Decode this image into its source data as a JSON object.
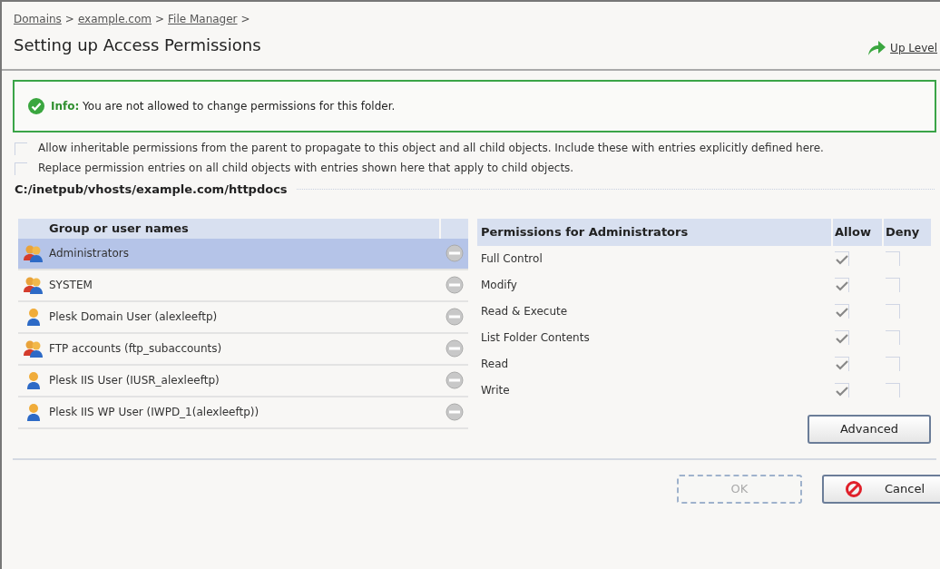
{
  "breadcrumb": [
    {
      "label": "Domains"
    },
    {
      "label": "example.com"
    },
    {
      "label": "File Manager"
    }
  ],
  "separator": ">",
  "title": "Setting up Access Permissions",
  "up_level": "Up Level",
  "info": "**Info:** You are not allowed to change permissions for this folder.",
  "options": [
    {
      "label": "Allow inheritable permissions from the parent to propagate to this object and all child objects. Include these with entries explicitly defined here.",
      "checked": false
    },
    {
      "label": "Replace permission entries on all child objects with entries shown here that apply to child objects.",
      "checked": false
    }
  ],
  "path": "C:/inetpub/vhosts/example.com/httpdocs",
  "users": {
    "heading": "Group or user names",
    "rows": [
      {
        "name": "Administrators",
        "kind": "group",
        "selected": true
      },
      {
        "name": "SYSTEM",
        "kind": "group",
        "selected": false
      },
      {
        "name": "Plesk Domain User (alexleeftp)",
        "kind": "user",
        "selected": false
      },
      {
        "name": "FTP accounts (ftp_subaccounts)",
        "kind": "group",
        "selected": false
      },
      {
        "name": "Plesk IIS User (IUSR_alexleeftp)",
        "kind": "user",
        "selected": false
      },
      {
        "name": "Plesk IIS WP User (IWPD_1(alexleeftp))",
        "kind": "user",
        "selected": false
      }
    ]
  },
  "permissions": {
    "heading": "Permissions for Administrators",
    "allow_heading": "Allow",
    "deny_heading": "Deny",
    "rows": [
      {
        "name": "Full Control",
        "allow": true,
        "deny": false
      },
      {
        "name": "Modify",
        "allow": true,
        "deny": false
      },
      {
        "name": "Read & Execute",
        "allow": true,
        "deny": false
      },
      {
        "name": "List Folder Contents",
        "allow": true,
        "deny": false
      },
      {
        "name": "Read",
        "allow": true,
        "deny": false
      },
      {
        "name": "Write",
        "allow": true,
        "deny": false
      }
    ]
  },
  "advanced_button": "Advanced",
  "buttons": [
    {
      "label": "OK",
      "disabled": true,
      "kind": "ok"
    },
    {
      "label": "Cancel",
      "disabled": false,
      "kind": "cancel"
    }
  ]
}
